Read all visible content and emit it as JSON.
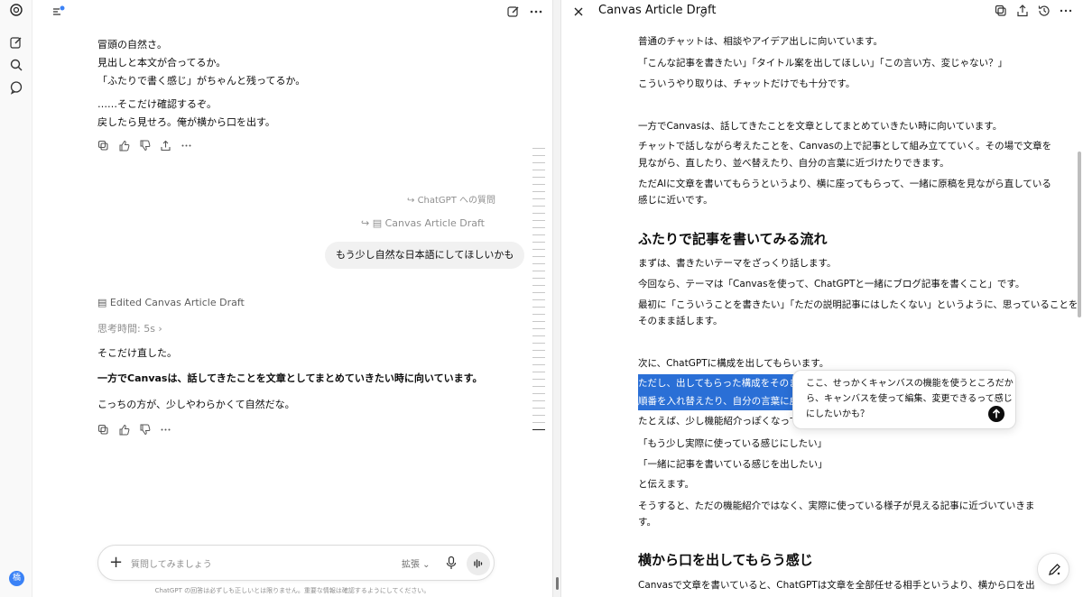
{
  "rail": {
    "avatar_letter": "橋",
    "icons": [
      "openai-logo-icon",
      "new-chat-icon",
      "search-icon",
      "chat-bubble-icon"
    ]
  },
  "chat": {
    "assistant_msg_1": [
      "冒頭の自然さ。",
      "見出しと本文が合ってるか。",
      "「ふたりで書く感じ」がちゃんと残ってるか。",
      "……そこだけ確認するぞ。",
      "戻したら見せろ。俺が横から口を出す。"
    ],
    "reference_question": "ChatGPT への質問",
    "reference_canvas": "Canvas Article Draft",
    "user_msg": "もう少し自然な日本語にしてほしいかも",
    "edited_label": "Edited Canvas Article Draft",
    "thinking_time": "思考時間: 5s",
    "assistant_msg_2_a": "そこだけ直した。",
    "assistant_msg_2_b": "一方でCanvasは、話してきたことを文章としてまとめていきたい時に向いています。",
    "assistant_msg_2_c": "こっちの方が、少しやわらかくて自然だな。",
    "composer_placeholder": "質問してみましょう",
    "composer_extend": "拡張",
    "disclaimer": "ChatGPT の回答は必ずしも正しいとは限りません。重要な情報は確認するようにしてください。"
  },
  "canvas": {
    "title": "Canvas Article Draft",
    "lines_1": [
      "普通のチャットは、相談やアイデア出しに向いています。",
      "「こんな記事を書きたい」「タイトル案を出してほしい」「この言い方、変じゃない？」",
      "こういうやり取りは、チャットだけでも十分です。"
    ],
    "lines_2": [
      "一方でCanvasは、話してきたことを文章としてまとめていきたい時に向いています。",
      "チャットで話しながら考えたことを、Canvasの上で記事として組み立てていく。その場で文章を",
      "見ながら、直したり、並べ替えたり、自分の言葉に近づけたりできます。",
      "ただAIに文章を書いてもらうというより、横に座ってもらって、一緒に原稿を見ながら直している",
      "感じに近いです。"
    ],
    "heading_1": "ふたりで記事を書いてみる流れ",
    "lines_3": [
      "まずは、書きたいテーマをざっくり話します。",
      "今回なら、テーマは「Canvasを使って、ChatGPTと一緒にブログ記事を書くこと」です。",
      "最初に「こういうことを書きたい」「ただの説明記事にはしたくない」というように、思っていることを",
      "そのまま話します。"
    ],
    "line_4": "次に、ChatGPTに構成を出してもらいます。",
    "highlight_1": "ただし、出してもらった構成をそのまま使う",
    "highlight_2": "順番を入れ替えたり、自分の言葉に戻",
    "line_5": "たとえば、少し機能紹介っぽくなっていた",
    "lines_6": [
      "「もう少し実際に使っている感じにしたい」",
      "「一緒に記事を書いている感じを出したい」",
      "と伝えます。",
      "そうすると、ただの機能紹介ではなく、実際に使っている様子が見える記事に近づいていきま",
      "す。"
    ],
    "heading_2": "横から口を出してもらう感じ",
    "line_7": "Canvasで文章を書いていると、ChatGPTは文章を全部任せる相手というより、横から口を出",
    "popup_lines": [
      "ここ、せっかくキャンバスの機能を使うところだか",
      "ら、キャンバスを使って編集、変更できるって感じ",
      "にしたいかも？"
    ]
  }
}
